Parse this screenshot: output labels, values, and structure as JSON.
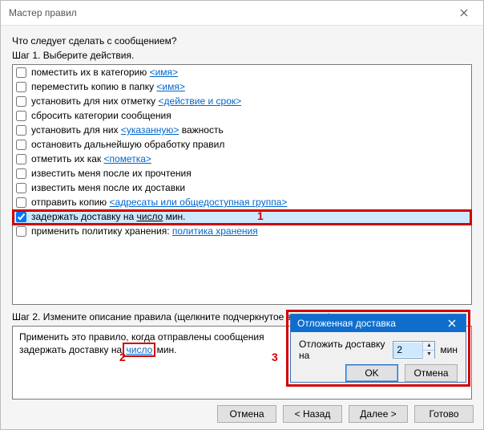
{
  "window": {
    "title": "Мастер правил"
  },
  "step1": {
    "question": "Что следует сделать с сообщением?",
    "label": "Шаг 1. Выберите действия."
  },
  "actions": [
    {
      "checked": false,
      "pre": "поместить их в категорию ",
      "link": "<имя>",
      "post": "",
      "interactable_link": true
    },
    {
      "checked": false,
      "pre": "переместить копию в папку ",
      "link": "<имя>",
      "post": "",
      "interactable_link": true
    },
    {
      "checked": false,
      "pre": "установить для них отметку ",
      "link": "<действие и срок>",
      "post": "",
      "interactable_link": true
    },
    {
      "checked": false,
      "pre": "сбросить категории сообщения",
      "link": "",
      "post": "",
      "interactable_link": false
    },
    {
      "checked": false,
      "pre": "установить для них ",
      "link": "<указанную>",
      "post": " важность",
      "interactable_link": true
    },
    {
      "checked": false,
      "pre": "остановить дальнейшую обработку правил",
      "link": "",
      "post": "",
      "interactable_link": false
    },
    {
      "checked": false,
      "pre": "отметить их как ",
      "link": "<пометка>",
      "post": "",
      "interactable_link": true
    },
    {
      "checked": false,
      "pre": "известить меня после их прочтения",
      "link": "",
      "post": "",
      "interactable_link": false
    },
    {
      "checked": false,
      "pre": "известить меня после их доставки",
      "link": "",
      "post": "",
      "interactable_link": false
    },
    {
      "checked": false,
      "pre": "отправить копию ",
      "link": "<адресаты или общедоступная группа>",
      "post": "",
      "interactable_link": true
    },
    {
      "checked": true,
      "pre": "задержать доставку на ",
      "link": "число",
      "post": " мин.",
      "interactable_link": true,
      "link_plain": true,
      "selected": true
    },
    {
      "checked": false,
      "pre": "применить политику хранения: ",
      "link": "политика хранения",
      "post": "",
      "interactable_link": true
    }
  ],
  "step2": {
    "label": "Шаг 2. Измените описание правила (щелкните подчеркнутое значение).",
    "line1": "Применить это правило, когда отправлены сообщения",
    "line2_pre": "задержать доставку на ",
    "line2_link": "число",
    "line2_post": " мин."
  },
  "dialog": {
    "title": "Отложенная доставка",
    "body_pre": "Отложить доставку на",
    "value": "2",
    "body_post": "мин",
    "ok": "OK",
    "cancel": "Отмена"
  },
  "footer": {
    "cancel": "Отмена",
    "back": "< Назад",
    "next": "Далее >",
    "finish": "Готово"
  },
  "annotations": {
    "a1": "1",
    "a2": "2",
    "a3": "3"
  }
}
